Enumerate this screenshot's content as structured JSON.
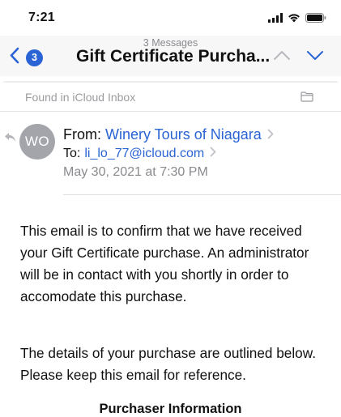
{
  "status_bar": {
    "time": "7:21",
    "icons": [
      "signal-bars-icon",
      "wifi-icon",
      "battery-icon"
    ]
  },
  "nav": {
    "subtitle": "3 Messages",
    "title": "Gift Certificate Purcha...",
    "back_badge_count": "3",
    "icons": [
      "chevron-left-icon",
      "chevron-up-icon",
      "chevron-down-icon"
    ]
  },
  "banner": {
    "text": "Found in iCloud Inbox",
    "icon": "folder-icon"
  },
  "header": {
    "avatar_initials": "WO",
    "from_label": "From:",
    "from_name": "Winery Tours of Niagara",
    "to_label": "To:",
    "to_address": "li_lo_77@icloud.com",
    "date": "May 30, 2021 at 7:30 PM"
  },
  "body": {
    "paragraph_1": "This email is to confirm that we have received your Gift Certificate purchase. An administrator will be in contact with you shortly in order to accomodate this purchase.",
    "paragraph_2": "The details of your purchase are outlined below. Please keep this email for reference.",
    "section_heading": "Purchaser Information"
  },
  "colors": {
    "accent": "#2a63d4",
    "secondary_text": "#8a8a8e",
    "avatar_bg": "#a3a5ab"
  }
}
